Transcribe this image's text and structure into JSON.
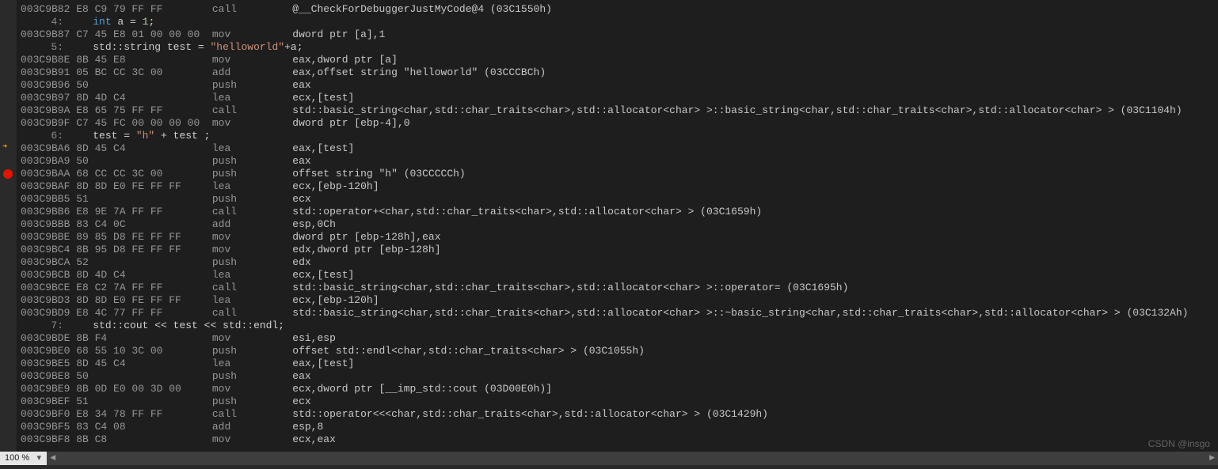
{
  "status": {
    "zoom": "100 %"
  },
  "watermark": "CSDN @insgo",
  "breakpoint_row_index": 13,
  "arrow_row_index": 13,
  "rows": [
    {
      "t": "asm",
      "addr": "003C9B82",
      "bytes": "E8 C9 79 FF FF",
      "mn": "call",
      "op": "@__CheckForDebuggerJustMyCode@4 (03C1550h)"
    },
    {
      "t": "src",
      "lnum": "4:",
      "src_html": "<span class='kw'>int</span> a = <span class='num'>1</span>;"
    },
    {
      "t": "asm",
      "addr": "003C9B87",
      "bytes": "C7 45 E8 01 00 00 00",
      "mn": "mov",
      "op": "dword ptr [a],1"
    },
    {
      "t": "src",
      "lnum": "5:",
      "src_html": "<span class='ns'>std::</span><span class='type'>string</span> test = <span class='str'>\"helloworld\"</span>+a;"
    },
    {
      "t": "asm",
      "addr": "003C9B8E",
      "bytes": "8B 45 E8",
      "mn": "mov",
      "op": "eax,dword ptr [a]"
    },
    {
      "t": "asm",
      "addr": "003C9B91",
      "bytes": "05 BC CC 3C 00",
      "mn": "add",
      "op": "eax,offset string \"helloworld\" (03CCCBCh)"
    },
    {
      "t": "asm",
      "addr": "003C9B96",
      "bytes": "50",
      "mn": "push",
      "op": "eax"
    },
    {
      "t": "asm",
      "addr": "003C9B97",
      "bytes": "8D 4D C4",
      "mn": "lea",
      "op": "ecx,[test]"
    },
    {
      "t": "asm",
      "addr": "003C9B9A",
      "bytes": "E8 65 75 FF FF",
      "mn": "call",
      "op": "std::basic_string<char,std::char_traits<char>,std::allocator<char> >::basic_string<char,std::char_traits<char>,std::allocator<char> > (03C1104h)"
    },
    {
      "t": "asm",
      "addr": "003C9B9F",
      "bytes": "C7 45 FC 00 00 00 00",
      "mn": "mov",
      "op": "dword ptr [ebp-4],0"
    },
    {
      "t": "src",
      "lnum": "6:",
      "src_html": "test = <span class='str'>\"h\"</span> + test ;"
    },
    {
      "t": "asm",
      "addr": "003C9BA6",
      "bytes": "8D 45 C4",
      "mn": "lea",
      "op": "eax,[test]"
    },
    {
      "t": "asm",
      "addr": "003C9BA9",
      "bytes": "50",
      "mn": "push",
      "op": "eax"
    },
    {
      "t": "asm",
      "addr": "003C9BAA",
      "bytes": "68 CC CC 3C 00",
      "mn": "push",
      "op": "offset string \"h\" (03CCCCCh)"
    },
    {
      "t": "asm",
      "addr": "003C9BAF",
      "bytes": "8D 8D E0 FE FF FF",
      "mn": "lea",
      "op": "ecx,[ebp-120h]"
    },
    {
      "t": "asm",
      "addr": "003C9BB5",
      "bytes": "51",
      "mn": "push",
      "op": "ecx"
    },
    {
      "t": "asm",
      "addr": "003C9BB6",
      "bytes": "E8 9E 7A FF FF",
      "mn": "call",
      "op": "std::operator+<char,std::char_traits<char>,std::allocator<char> > (03C1659h)"
    },
    {
      "t": "asm",
      "addr": "003C9BBB",
      "bytes": "83 C4 0C",
      "mn": "add",
      "op": "esp,0Ch"
    },
    {
      "t": "asm",
      "addr": "003C9BBE",
      "bytes": "89 85 D8 FE FF FF",
      "mn": "mov",
      "op": "dword ptr [ebp-128h],eax"
    },
    {
      "t": "asm",
      "addr": "003C9BC4",
      "bytes": "8B 95 D8 FE FF FF",
      "mn": "mov",
      "op": "edx,dword ptr [ebp-128h]"
    },
    {
      "t": "asm",
      "addr": "003C9BCA",
      "bytes": "52",
      "mn": "push",
      "op": "edx"
    },
    {
      "t": "asm",
      "addr": "003C9BCB",
      "bytes": "8D 4D C4",
      "mn": "lea",
      "op": "ecx,[test]"
    },
    {
      "t": "asm",
      "addr": "003C9BCE",
      "bytes": "E8 C2 7A FF FF",
      "mn": "call",
      "op": "std::basic_string<char,std::char_traits<char>,std::allocator<char> >::operator= (03C1695h)"
    },
    {
      "t": "asm",
      "addr": "003C9BD3",
      "bytes": "8D 8D E0 FE FF FF",
      "mn": "lea",
      "op": "ecx,[ebp-120h]"
    },
    {
      "t": "asm",
      "addr": "003C9BD9",
      "bytes": "E8 4C 77 FF FF",
      "mn": "call",
      "op": "std::basic_string<char,std::char_traits<char>,std::allocator<char> >::~basic_string<char,std::char_traits<char>,std::allocator<char> > (03C132Ah)"
    },
    {
      "t": "src",
      "lnum": "7:",
      "src_html": "<span class='ns'>std::</span>cout &lt;&lt; test &lt;&lt; <span class='ns'>std::</span>endl;"
    },
    {
      "t": "asm",
      "addr": "003C9BDE",
      "bytes": "8B F4",
      "mn": "mov",
      "op": "esi,esp"
    },
    {
      "t": "asm",
      "addr": "003C9BE0",
      "bytes": "68 55 10 3C 00",
      "mn": "push",
      "op": "offset std::endl<char,std::char_traits<char> > (03C1055h)"
    },
    {
      "t": "asm",
      "addr": "003C9BE5",
      "bytes": "8D 45 C4",
      "mn": "lea",
      "op": "eax,[test]"
    },
    {
      "t": "asm",
      "addr": "003C9BE8",
      "bytes": "50",
      "mn": "push",
      "op": "eax"
    },
    {
      "t": "asm",
      "addr": "003C9BE9",
      "bytes": "8B 0D E0 00 3D 00",
      "mn": "mov",
      "op": "ecx,dword ptr [__imp_std::cout (03D00E0h)]"
    },
    {
      "t": "asm",
      "addr": "003C9BEF",
      "bytes": "51",
      "mn": "push",
      "op": "ecx"
    },
    {
      "t": "asm",
      "addr": "003C9BF0",
      "bytes": "E8 34 78 FF FF",
      "mn": "call",
      "op": "std::operator<<<char,std::char_traits<char>,std::allocator<char> > (03C1429h)"
    },
    {
      "t": "asm",
      "addr": "003C9BF5",
      "bytes": "83 C4 08",
      "mn": "add",
      "op": "esp,8"
    },
    {
      "t": "asm",
      "addr": "003C9BF8",
      "bytes": "8B C8",
      "mn": "mov",
      "op": "ecx,eax"
    }
  ]
}
